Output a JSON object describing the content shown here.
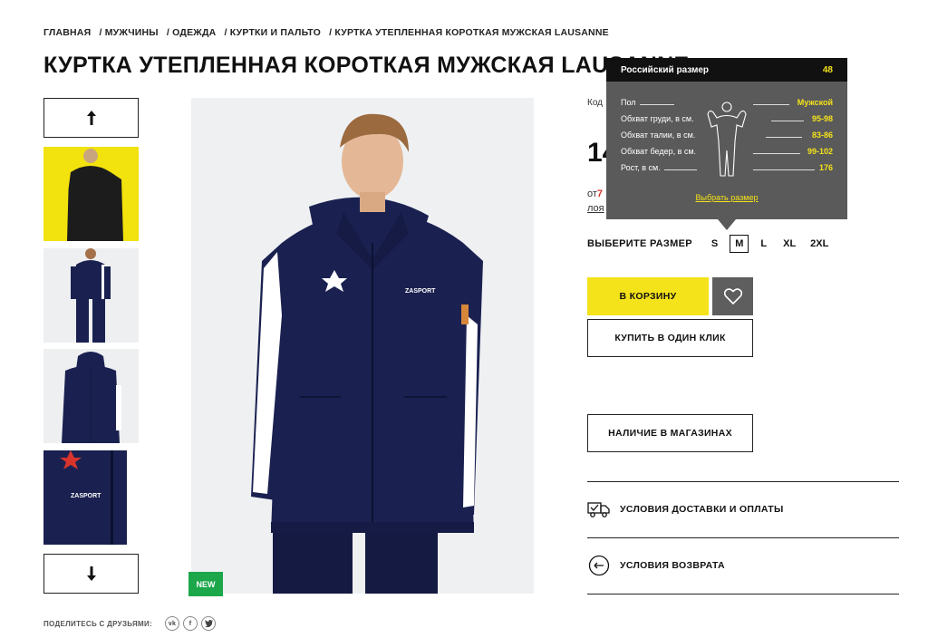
{
  "breadcrumb": [
    "ГЛАВНАЯ",
    "/ МУЖЧИНЫ",
    "/ ОДЕЖДА",
    "/ КУРТКИ И ПАЛЬТО",
    "/ КУРТКА УТЕПЛЕННАЯ КОРОТКАЯ МУЖСКАЯ LAUSANNE"
  ],
  "product": {
    "title": "КУРТКА УТЕПЛЕННАЯ КОРОТКАЯ МУЖСКАЯ LAUSANNE",
    "code_label_partial": "Код",
    "price_partial": "14",
    "loyalty_line1_prefix": "от",
    "loyalty_line1_value": "7",
    "loyalty_line2_partial": "лоя",
    "badge": "NEW",
    "brand_print": "ZASPORT"
  },
  "sizes": {
    "label": "ВЫБЕРИТЕ РАЗМЕР",
    "options": [
      "S",
      "M",
      "L",
      "XL",
      "2XL"
    ],
    "selected": "M"
  },
  "buttons": {
    "cart": "В КОРЗИНУ",
    "one_click": "КУПИТЬ В ОДИН КЛИК",
    "stores": "НАЛИЧИЕ В МАГАЗИНАХ"
  },
  "info": {
    "delivery": "УСЛОВИЯ ДОСТАВКИ И ОПЛАТЫ",
    "returns": "УСЛОВИЯ ВОЗВРАТА"
  },
  "share": {
    "label": "ПОДЕЛИТЕСЬ С ДРУЗЬЯМИ:",
    "networks": [
      "vk-icon",
      "facebook-icon",
      "twitter-icon"
    ]
  },
  "size_tooltip": {
    "header_label": "Российский размер",
    "header_value": "48",
    "rows": [
      {
        "key": "Пол",
        "value": "Мужской"
      },
      {
        "key": "Обхват груди, в см.",
        "value": "95-98"
      },
      {
        "key": "Обхват талии, в см.",
        "value": "83-86"
      },
      {
        "key": "Обхват бедер, в см.",
        "value": "99-102"
      },
      {
        "key": "Рост, в см.",
        "value": "176"
      }
    ],
    "choose_link": "Выбрать размер"
  },
  "colors": {
    "accent_yellow": "#f4e21a",
    "new_green": "#1ba74a",
    "tooltip_bg": "#5a5a5a",
    "jacket_navy": "#1a2150"
  }
}
